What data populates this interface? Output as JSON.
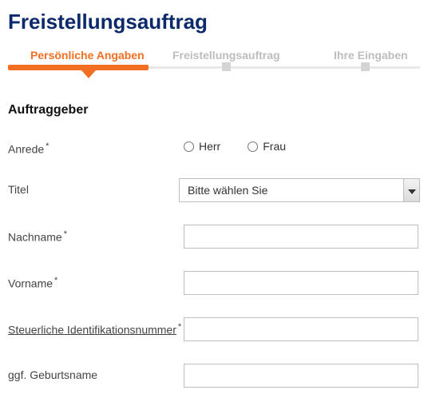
{
  "title": "Freistellungsauftrag",
  "steps": {
    "s1": "Persönliche Angaben",
    "s2": "Freistellungsauftrag",
    "s3": "Ihre Eingaben",
    "activeIndex": 0
  },
  "section": {
    "heading": "Auftraggeber"
  },
  "form": {
    "salutation": {
      "label": "Anrede",
      "required": true,
      "options": {
        "herr": "Herr",
        "frau": "Frau"
      },
      "value": null
    },
    "title": {
      "label": "Titel",
      "placeholder": "Bitte wählen Sie",
      "value": null
    },
    "lastname": {
      "label": "Nachname",
      "required": true,
      "value": ""
    },
    "firstname": {
      "label": "Vorname",
      "required": true,
      "value": ""
    },
    "taxid": {
      "label": "Steuerliche Identifikationsnummer",
      "required": true,
      "value": ""
    },
    "birthname": {
      "label": "ggf. Geburtsname",
      "required": false,
      "value": ""
    }
  }
}
